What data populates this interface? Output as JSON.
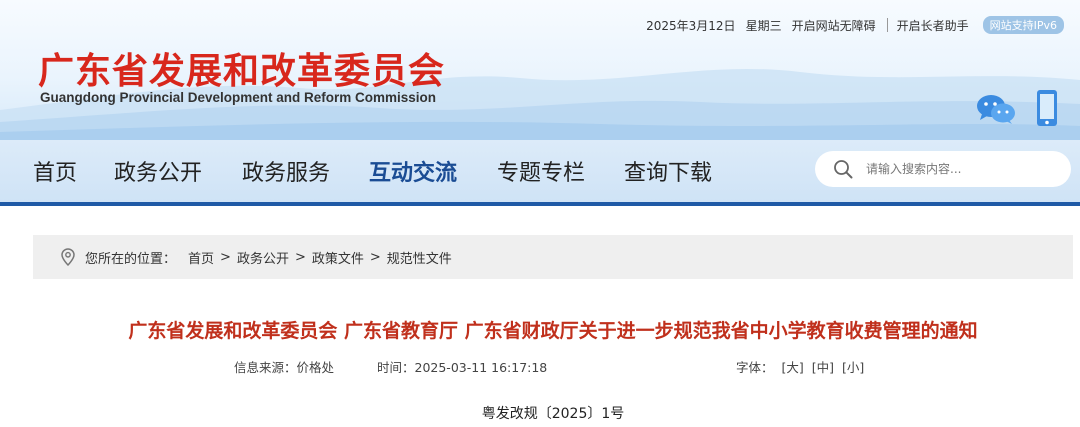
{
  "topbar": {
    "date": "2025年3月12日",
    "weekday": "星期三",
    "accessibility": "开启网站无障碍",
    "elderly": "开启长者助手",
    "ipv6": "网站支持IPv6"
  },
  "logo": {
    "name_cn": "广东省发展和改革委员会",
    "name_en": "Guangdong Provincial Development and Reform Commission"
  },
  "nav": {
    "items": [
      "首页",
      "政务公开",
      "政务服务",
      "互动交流",
      "专题专栏",
      "查询下载"
    ],
    "active": "互动交流"
  },
  "search": {
    "placeholder": "请输入搜索内容..."
  },
  "breadcrumb": {
    "prefix": "您所在的位置：",
    "items": [
      "首页",
      "政务公开",
      "政策文件",
      "规范性文件"
    ],
    "separator": ">"
  },
  "article": {
    "title": "广东省发展和改革委员会 广东省教育厅 广东省财政厅关于进一步规范我省中小学教育收费管理的通知",
    "source": "信息来源：价格处",
    "time": "时间：2025-03-11 16:17:18",
    "font_label": "字体：",
    "font_sizes": [
      "[大]",
      "[中]",
      "[小]"
    ],
    "doc_number": "粤发改规〔2025〕1号"
  },
  "colors": {
    "brand_red": "#d8271c",
    "nav_blue": "#1f5aa6",
    "title_red": "#c0301c"
  }
}
